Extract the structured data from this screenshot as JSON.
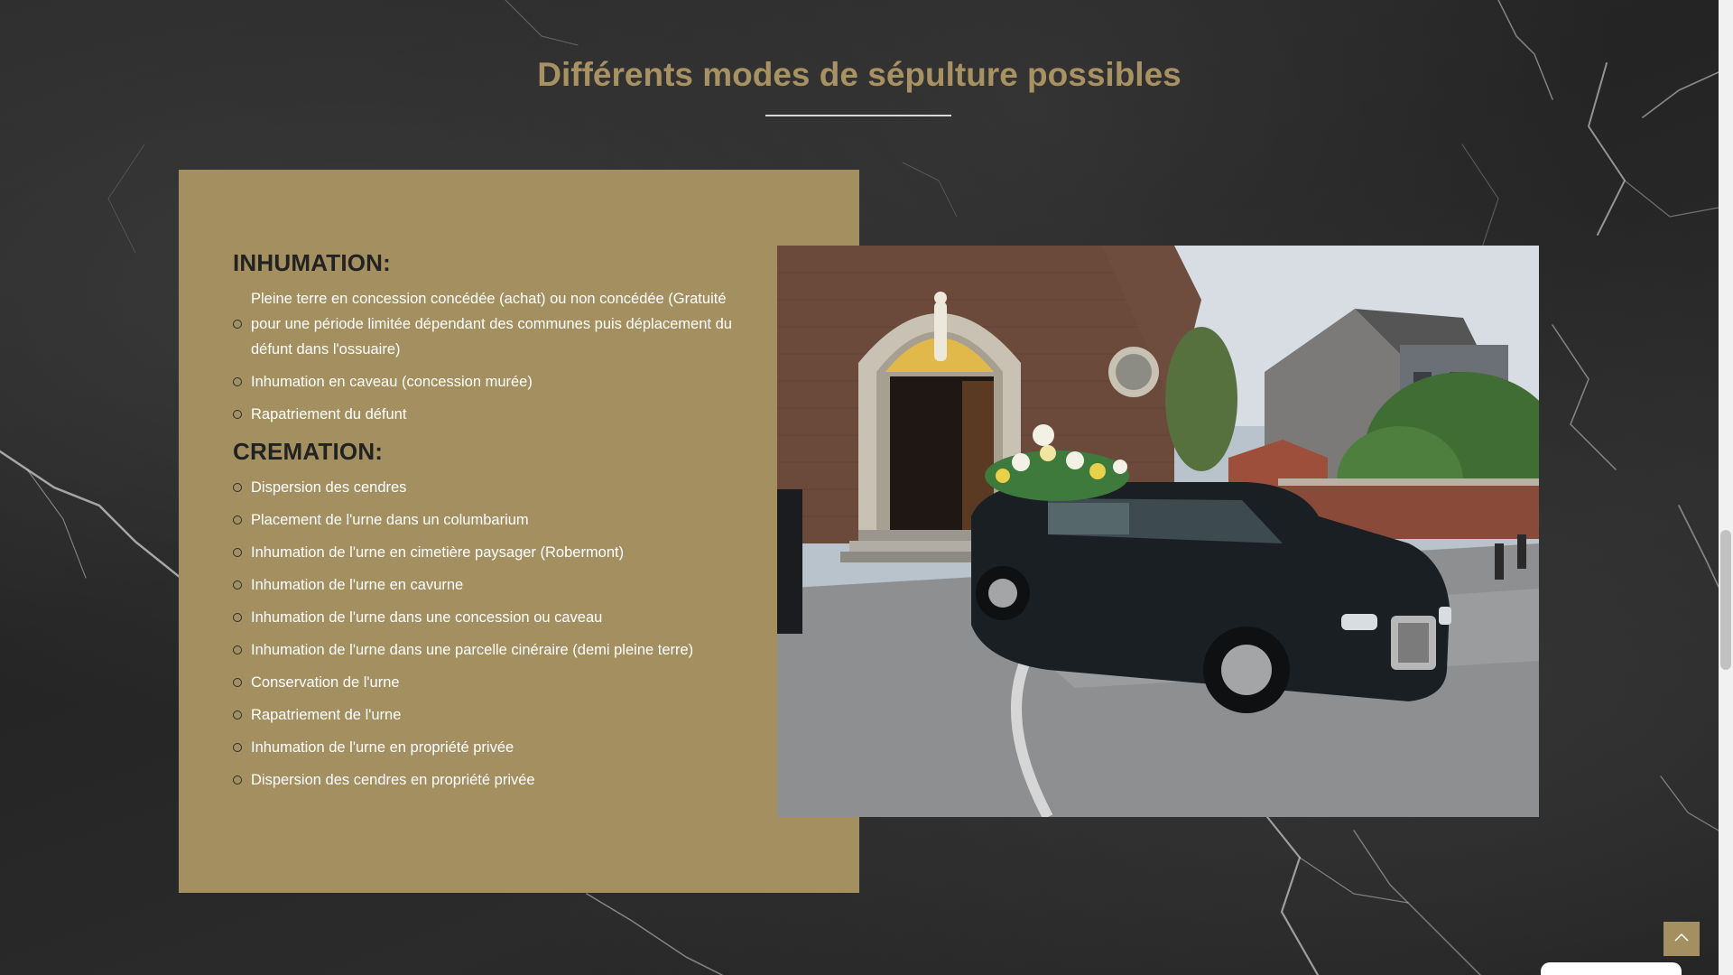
{
  "section": {
    "title": "Différents modes de sépulture possibles"
  },
  "inhumation": {
    "heading": "INHUMATION:",
    "items": [
      "Pleine terre en concession concédée (achat) ou non concédée (Gratuité pour une période limitée dépendant des communes puis déplacement du défunt dans l'ossuaire)",
      "Inhumation en caveau (concession murée)",
      "Rapatriement du défunt"
    ]
  },
  "cremation": {
    "heading": "CREMATION:",
    "items": [
      "Dispersion des cendres",
      "Placement de l'urne dans un columbarium",
      "Inhumation de l'urne en cimetière paysager (Robermont)",
      "Inhumation de l'urne en cavurne",
      "Inhumation de l'urne dans une concession ou caveau",
      "Inhumation de l'urne dans une parcelle cinéraire (demi pleine terre)",
      "Conservation de l'urne",
      "Rapatriement de l'urne",
      "Inhumation de l'urne en propriété privée",
      "Dispersion des cendres en propriété privée"
    ]
  },
  "photo": {
    "icon": "hearse-church-photo"
  },
  "controls": {
    "back_to_top_icon": "chevron-up-icon"
  },
  "colors": {
    "accent_gold": "#a48f60",
    "title_gold": "#a89162",
    "background": "#2a2a2a"
  }
}
